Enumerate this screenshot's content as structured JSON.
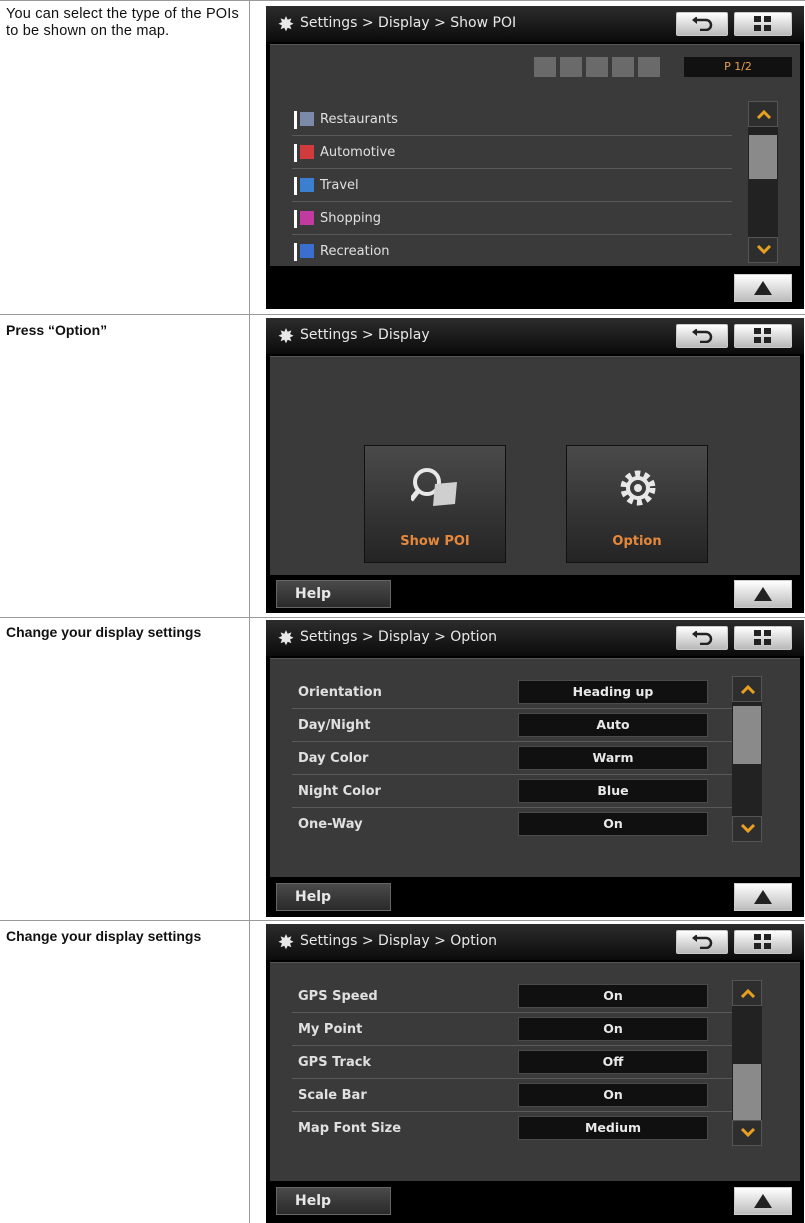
{
  "rows": [
    {
      "description": "You can select the type of the POIs to be shown on the map.",
      "screen": {
        "breadcrumb": "Settings > Display > Show POI",
        "page_indicator": "P 1/2",
        "items": [
          {
            "label": "Restaurants",
            "icon": "restaurant-icon",
            "color": "#7a8aa8"
          },
          {
            "label": "Automotive",
            "icon": "car-icon",
            "color": "#d23b3b"
          },
          {
            "label": "Travel",
            "icon": "travel-icon",
            "color": "#3a7fd0"
          },
          {
            "label": "Shopping",
            "icon": "shopping-icon",
            "color": "#c03aa0"
          },
          {
            "label": "Recreation",
            "icon": "recreation-icon",
            "color": "#3a6fd0"
          }
        ]
      }
    },
    {
      "description": "Press “Option”",
      "screen": {
        "breadcrumb": "Settings > Display",
        "tiles": [
          {
            "label": "Show POI",
            "icon": "magnifier-map-icon"
          },
          {
            "label": "Option",
            "icon": "gear-icon"
          }
        ],
        "help_label": "Help"
      }
    },
    {
      "description": "Change your display settings",
      "screen": {
        "breadcrumb": "Settings > Display > Option",
        "options": [
          {
            "label": "Orientation",
            "value": "Heading up"
          },
          {
            "label": "Day/Night",
            "value": "Auto"
          },
          {
            "label": "Day Color",
            "value": "Warm"
          },
          {
            "label": "Night Color",
            "value": "Blue"
          },
          {
            "label": "One-Way",
            "value": "On"
          }
        ],
        "help_label": "Help"
      }
    },
    {
      "description": "Change your display settings",
      "screen": {
        "breadcrumb": "Settings > Display > Option",
        "options": [
          {
            "label": "GPS Speed",
            "value": "On"
          },
          {
            "label": "My Point",
            "value": "On"
          },
          {
            "label": "GPS Track",
            "value": "Off"
          },
          {
            "label": "Scale Bar",
            "value": "On"
          },
          {
            "label": "Map Font Size",
            "value": "Medium"
          }
        ],
        "help_label": "Help"
      }
    }
  ],
  "colors": {
    "accent_orange": "#e6883c",
    "scroll_arrow": "#e8a020",
    "panel_bg": "#3a3a3a"
  }
}
